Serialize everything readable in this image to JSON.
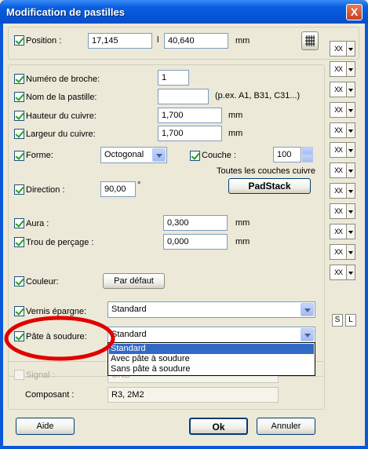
{
  "window": {
    "title": "Modification de pastilles",
    "close_glyph": "X"
  },
  "position": {
    "label": "Position :",
    "x": "17,145",
    "separator": "l",
    "y": "40,640",
    "unit": "mm",
    "grid_icon": "grid-icon"
  },
  "fields": {
    "broche": {
      "label": "Numéro de broche:",
      "value": "1"
    },
    "nom": {
      "label": "Nom de la pastille:",
      "value": "",
      "hint": "(p.ex. A1, B31, C31...)"
    },
    "hauteur": {
      "label": "Hauteur du cuivre:",
      "value": "1,700",
      "unit": "mm"
    },
    "largeur": {
      "label": "Largeur du cuivre:",
      "value": "1,700",
      "unit": "mm"
    },
    "forme": {
      "label": "Forme:",
      "value": "Octogonal"
    },
    "couche": {
      "label": "Couche :",
      "value": "100",
      "note": "Toutes les couches cuivre"
    },
    "padstack": {
      "label": "PadStack"
    },
    "direction": {
      "label": "Direction :",
      "value": "90,00",
      "unit": "°"
    },
    "aura": {
      "label": "Aura :",
      "value": "0,300",
      "unit": "mm"
    },
    "trou": {
      "label": "Trou de perçage :",
      "value": "0,000",
      "unit": "mm"
    },
    "couleur": {
      "label": "Couleur:",
      "button": "Par défaut"
    },
    "vernis": {
      "label": "Vernis épargne:",
      "value": "Standard"
    },
    "pate": {
      "label": "Pâte à soudure:",
      "value": "Standard",
      "options": [
        "Standard",
        "Avec pâte à soudure",
        "Sans pâte à soudure"
      ]
    },
    "signal": {
      "label": "Signal :",
      "value": "GND"
    },
    "composant": {
      "label": "Composant :",
      "value": "R3, 2M2"
    }
  },
  "side": {
    "xx_label": "XX",
    "s_label": "S",
    "l_label": "L"
  },
  "footer": {
    "help": "Aide",
    "ok": "Ok",
    "cancel": "Annuler"
  },
  "colors": {
    "titlebar": "#0a5fe0",
    "highlight_ellipse": "#e00000",
    "selection": "#316ac5"
  }
}
